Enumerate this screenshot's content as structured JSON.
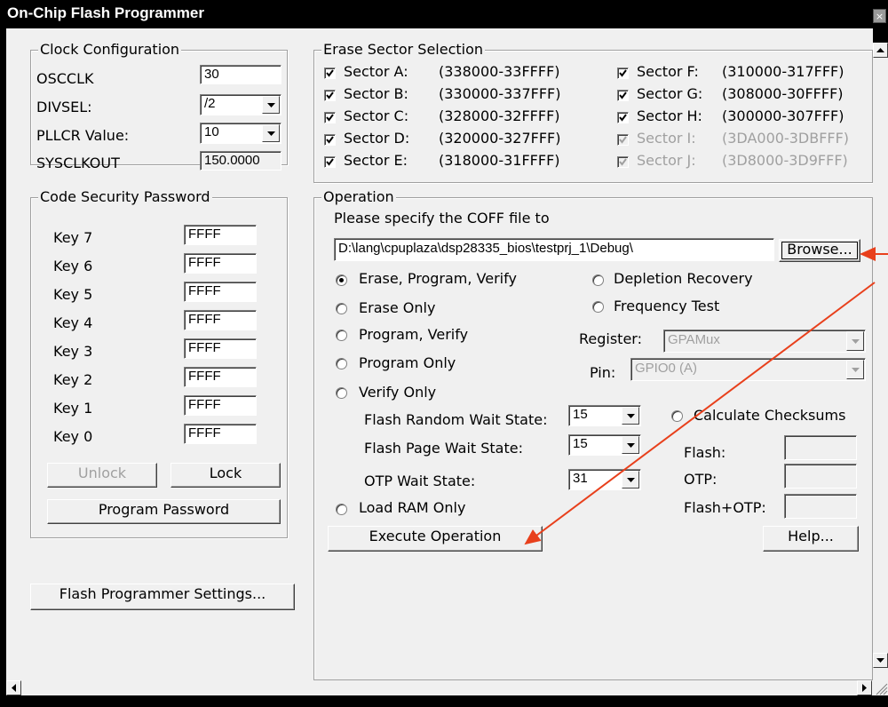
{
  "window": {
    "title": "On-Chip Flash Programmer",
    "close_glyph": "×"
  },
  "clock": {
    "legend": "Clock Configuration",
    "osc_label": "OSCCLK",
    "osc_value": "30",
    "divsel_label": "DIVSEL:",
    "divsel_value": "/2",
    "pllcr_label": "PLLCR Value:",
    "pllcr_value": "10",
    "sysclk_label": "SYSCLKOUT",
    "sysclk_value": "150.0000"
  },
  "security": {
    "legend": "Code Security Password",
    "keys": [
      {
        "label": "Key 7",
        "value": "FFFF"
      },
      {
        "label": "Key 6",
        "value": "FFFF"
      },
      {
        "label": "Key 5",
        "value": "FFFF"
      },
      {
        "label": "Key 4",
        "value": "FFFF"
      },
      {
        "label": "Key 3",
        "value": "FFFF"
      },
      {
        "label": "Key 2",
        "value": "FFFF"
      },
      {
        "label": "Key 1",
        "value": "FFFF"
      },
      {
        "label": "Key 0",
        "value": "FFFF"
      }
    ],
    "unlock_label": "Unlock",
    "lock_label": "Lock",
    "program_password_label": "Program Password"
  },
  "settings_button": "Flash Programmer Settings...",
  "erase": {
    "legend": "Erase Sector Selection",
    "sectors": [
      {
        "name": "Sector A:",
        "range": "(338000-33FFFF)",
        "checked": true,
        "enabled": true
      },
      {
        "name": "Sector B:",
        "range": "(330000-337FFF)",
        "checked": true,
        "enabled": true
      },
      {
        "name": "Sector C:",
        "range": "(328000-32FFFF)",
        "checked": true,
        "enabled": true
      },
      {
        "name": "Sector D:",
        "range": "(320000-327FFF)",
        "checked": true,
        "enabled": true
      },
      {
        "name": "Sector E:",
        "range": "(318000-31FFFF)",
        "checked": true,
        "enabled": true
      },
      {
        "name": "Sector F:",
        "range": "(310000-317FFF)",
        "checked": true,
        "enabled": true
      },
      {
        "name": "Sector G:",
        "range": "(308000-30FFFF)",
        "checked": true,
        "enabled": true
      },
      {
        "name": "Sector H:",
        "range": "(300000-307FFF)",
        "checked": true,
        "enabled": true
      },
      {
        "name": "Sector I:",
        "range": "(3DA000-3DBFFF)",
        "checked": true,
        "enabled": false
      },
      {
        "name": "Sector J:",
        "range": "(3D8000-3D9FFF)",
        "checked": true,
        "enabled": false
      }
    ]
  },
  "operation": {
    "legend": "Operation",
    "coff_prompt": "Please specify the COFF file to",
    "coff_path": "D:\\lang\\cpuplaza\\dsp28335_bios\\testprj_1\\Debug\\",
    "browse_label": "Browse...",
    "modes": [
      {
        "label": "Erase, Program, Verify",
        "selected": true
      },
      {
        "label": "Erase Only",
        "selected": false
      },
      {
        "label": "Program, Verify",
        "selected": false
      },
      {
        "label": "Program Only",
        "selected": false
      },
      {
        "label": "Verify Only",
        "selected": false
      },
      {
        "label": "Load RAM Only",
        "selected": false
      }
    ],
    "depletion_label": "Depletion Recovery",
    "frequency_label": "Frequency Test",
    "register_label": "Register:",
    "register_value": "GPAMux",
    "pin_label": "Pin:",
    "pin_value": "GPIO0 (A)",
    "flash_random_label": "Flash Random Wait State:",
    "flash_random_value": "15",
    "flash_page_label": "Flash Page Wait State:",
    "flash_page_value": "15",
    "otp_wait_label": "OTP Wait State:",
    "otp_wait_value": "31",
    "checksum_label": "Calculate Checksums",
    "flash_label": "Flash:",
    "otp_label": "OTP:",
    "flash_otp_label": "Flash+OTP:",
    "execute_label": "Execute Operation",
    "help_label": "Help..."
  },
  "colors": {
    "annotation_arrow": "#e8401c",
    "disabled_text": "#a0a0a0",
    "face": "#f0f0f0"
  }
}
